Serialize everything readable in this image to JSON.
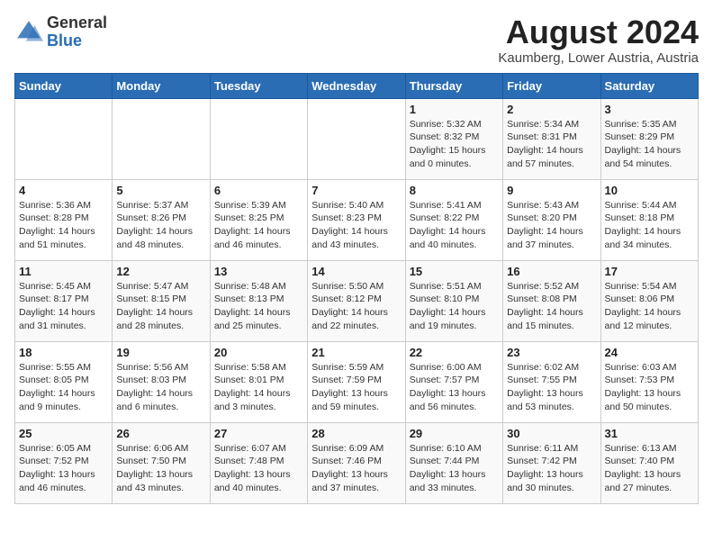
{
  "header": {
    "logo_general": "General",
    "logo_blue": "Blue",
    "month_year": "August 2024",
    "location": "Kaumberg, Lower Austria, Austria"
  },
  "weekdays": [
    "Sunday",
    "Monday",
    "Tuesday",
    "Wednesday",
    "Thursday",
    "Friday",
    "Saturday"
  ],
  "weeks": [
    [
      {
        "day": "",
        "info": ""
      },
      {
        "day": "",
        "info": ""
      },
      {
        "day": "",
        "info": ""
      },
      {
        "day": "",
        "info": ""
      },
      {
        "day": "1",
        "info": "Sunrise: 5:32 AM\nSunset: 8:32 PM\nDaylight: 15 hours\nand 0 minutes."
      },
      {
        "day": "2",
        "info": "Sunrise: 5:34 AM\nSunset: 8:31 PM\nDaylight: 14 hours\nand 57 minutes."
      },
      {
        "day": "3",
        "info": "Sunrise: 5:35 AM\nSunset: 8:29 PM\nDaylight: 14 hours\nand 54 minutes."
      }
    ],
    [
      {
        "day": "4",
        "info": "Sunrise: 5:36 AM\nSunset: 8:28 PM\nDaylight: 14 hours\nand 51 minutes."
      },
      {
        "day": "5",
        "info": "Sunrise: 5:37 AM\nSunset: 8:26 PM\nDaylight: 14 hours\nand 48 minutes."
      },
      {
        "day": "6",
        "info": "Sunrise: 5:39 AM\nSunset: 8:25 PM\nDaylight: 14 hours\nand 46 minutes."
      },
      {
        "day": "7",
        "info": "Sunrise: 5:40 AM\nSunset: 8:23 PM\nDaylight: 14 hours\nand 43 minutes."
      },
      {
        "day": "8",
        "info": "Sunrise: 5:41 AM\nSunset: 8:22 PM\nDaylight: 14 hours\nand 40 minutes."
      },
      {
        "day": "9",
        "info": "Sunrise: 5:43 AM\nSunset: 8:20 PM\nDaylight: 14 hours\nand 37 minutes."
      },
      {
        "day": "10",
        "info": "Sunrise: 5:44 AM\nSunset: 8:18 PM\nDaylight: 14 hours\nand 34 minutes."
      }
    ],
    [
      {
        "day": "11",
        "info": "Sunrise: 5:45 AM\nSunset: 8:17 PM\nDaylight: 14 hours\nand 31 minutes."
      },
      {
        "day": "12",
        "info": "Sunrise: 5:47 AM\nSunset: 8:15 PM\nDaylight: 14 hours\nand 28 minutes."
      },
      {
        "day": "13",
        "info": "Sunrise: 5:48 AM\nSunset: 8:13 PM\nDaylight: 14 hours\nand 25 minutes."
      },
      {
        "day": "14",
        "info": "Sunrise: 5:50 AM\nSunset: 8:12 PM\nDaylight: 14 hours\nand 22 minutes."
      },
      {
        "day": "15",
        "info": "Sunrise: 5:51 AM\nSunset: 8:10 PM\nDaylight: 14 hours\nand 19 minutes."
      },
      {
        "day": "16",
        "info": "Sunrise: 5:52 AM\nSunset: 8:08 PM\nDaylight: 14 hours\nand 15 minutes."
      },
      {
        "day": "17",
        "info": "Sunrise: 5:54 AM\nSunset: 8:06 PM\nDaylight: 14 hours\nand 12 minutes."
      }
    ],
    [
      {
        "day": "18",
        "info": "Sunrise: 5:55 AM\nSunset: 8:05 PM\nDaylight: 14 hours\nand 9 minutes."
      },
      {
        "day": "19",
        "info": "Sunrise: 5:56 AM\nSunset: 8:03 PM\nDaylight: 14 hours\nand 6 minutes."
      },
      {
        "day": "20",
        "info": "Sunrise: 5:58 AM\nSunset: 8:01 PM\nDaylight: 14 hours\nand 3 minutes."
      },
      {
        "day": "21",
        "info": "Sunrise: 5:59 AM\nSunset: 7:59 PM\nDaylight: 13 hours\nand 59 minutes."
      },
      {
        "day": "22",
        "info": "Sunrise: 6:00 AM\nSunset: 7:57 PM\nDaylight: 13 hours\nand 56 minutes."
      },
      {
        "day": "23",
        "info": "Sunrise: 6:02 AM\nSunset: 7:55 PM\nDaylight: 13 hours\nand 53 minutes."
      },
      {
        "day": "24",
        "info": "Sunrise: 6:03 AM\nSunset: 7:53 PM\nDaylight: 13 hours\nand 50 minutes."
      }
    ],
    [
      {
        "day": "25",
        "info": "Sunrise: 6:05 AM\nSunset: 7:52 PM\nDaylight: 13 hours\nand 46 minutes."
      },
      {
        "day": "26",
        "info": "Sunrise: 6:06 AM\nSunset: 7:50 PM\nDaylight: 13 hours\nand 43 minutes."
      },
      {
        "day": "27",
        "info": "Sunrise: 6:07 AM\nSunset: 7:48 PM\nDaylight: 13 hours\nand 40 minutes."
      },
      {
        "day": "28",
        "info": "Sunrise: 6:09 AM\nSunset: 7:46 PM\nDaylight: 13 hours\nand 37 minutes."
      },
      {
        "day": "29",
        "info": "Sunrise: 6:10 AM\nSunset: 7:44 PM\nDaylight: 13 hours\nand 33 minutes."
      },
      {
        "day": "30",
        "info": "Sunrise: 6:11 AM\nSunset: 7:42 PM\nDaylight: 13 hours\nand 30 minutes."
      },
      {
        "day": "31",
        "info": "Sunrise: 6:13 AM\nSunset: 7:40 PM\nDaylight: 13 hours\nand 27 minutes."
      }
    ]
  ]
}
